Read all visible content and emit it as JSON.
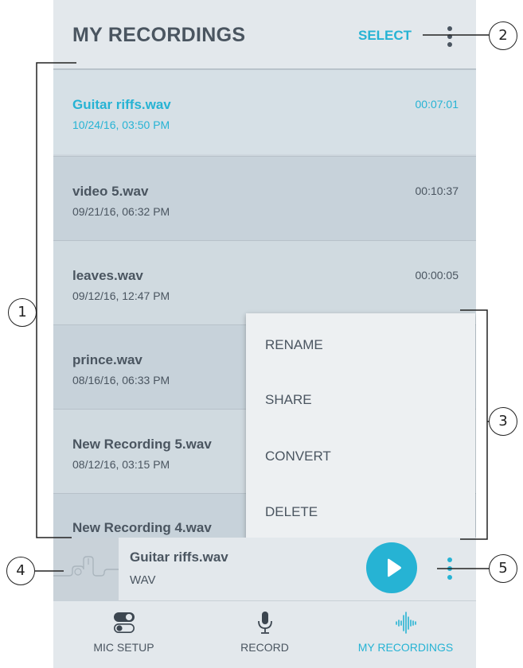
{
  "header": {
    "title": "MY RECORDINGS",
    "select_label": "SELECT"
  },
  "recordings": [
    {
      "name": "Guitar riffs.wav",
      "date": "10/24/16, 03:50 PM",
      "duration": "00:07:01"
    },
    {
      "name": "video 5.wav",
      "date": "09/21/16, 06:32 PM",
      "duration": "00:10:37"
    },
    {
      "name": "leaves.wav",
      "date": "09/12/16, 12:47 PM",
      "duration": "00:00:05"
    },
    {
      "name": "prince.wav",
      "date": "08/16/16, 06:33 PM",
      "duration": ""
    },
    {
      "name": "New Recording 5.wav",
      "date": "08/12/16, 03:15 PM",
      "duration": ""
    },
    {
      "name": "New Recording 4.wav",
      "date": "",
      "duration": ""
    }
  ],
  "context_menu": {
    "items": [
      "RENAME",
      "SHARE",
      "CONVERT",
      "DELETE"
    ]
  },
  "player": {
    "title": "Guitar riffs.wav",
    "format": "WAV"
  },
  "bottom_nav": {
    "items": [
      "MIC SETUP",
      "RECORD",
      "MY RECORDINGS"
    ],
    "active": "MY RECORDINGS"
  },
  "callouts": [
    "1",
    "2",
    "3",
    "4",
    "5"
  ],
  "colors": {
    "accent": "#26b3d4",
    "text": "#4a5560",
    "header_bg": "#e3e8ec",
    "list_bg": "#cfd8df"
  },
  "icons": [
    "kebab-menu-icon",
    "play-icon",
    "toggle-icon",
    "microphone-icon",
    "waveform-icon",
    "waveform-thumbnail"
  ]
}
